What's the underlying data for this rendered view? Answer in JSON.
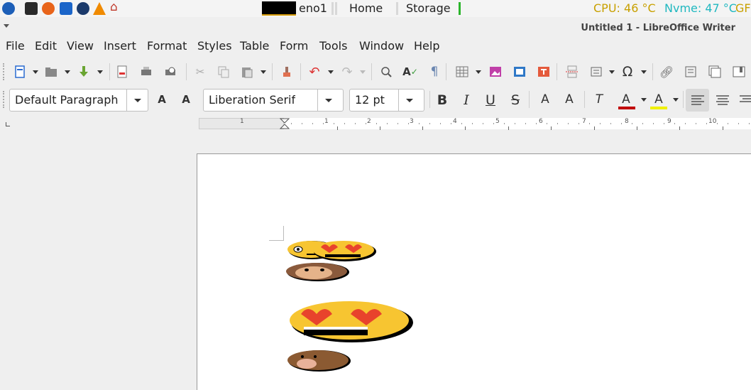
{
  "system_bar": {
    "net_interface": "eno1",
    "places": [
      "Home",
      "Storage"
    ],
    "cpu": "CPU: 46 °C",
    "nvme": "Nvme: 47 °C",
    "gpu_prefix": "GFX"
  },
  "window": {
    "title": "Untitled 1 - LibreOffice Writer"
  },
  "menu": [
    "File",
    "Edit",
    "View",
    "Insert",
    "Format",
    "Styles",
    "Table",
    "Form",
    "Tools",
    "Window",
    "Help"
  ],
  "formatting": {
    "paragraph_style": "Default Paragraph Style",
    "font_name": "Liberation Serif",
    "font_size": "12 pt",
    "bold": "B",
    "italic": "I",
    "underline": "U",
    "strike": "S"
  },
  "ruler": {
    "numbers": [
      "1",
      "1",
      "2",
      "3",
      "4",
      "5",
      "6",
      "7",
      "8",
      "9",
      "10"
    ]
  },
  "colors": {
    "cpu": "#c8a000",
    "nvme": "#20b8c0",
    "font_color": "#c00000",
    "highlight": "#f0f000",
    "storage_fill": "#2bb52b"
  },
  "document": {
    "images": [
      "wink-smiley-emoji",
      "heart-eyes-emoji",
      "monkey-face-emoji",
      "heart-eyes-emoji-large",
      "bear-face-emoji"
    ]
  }
}
